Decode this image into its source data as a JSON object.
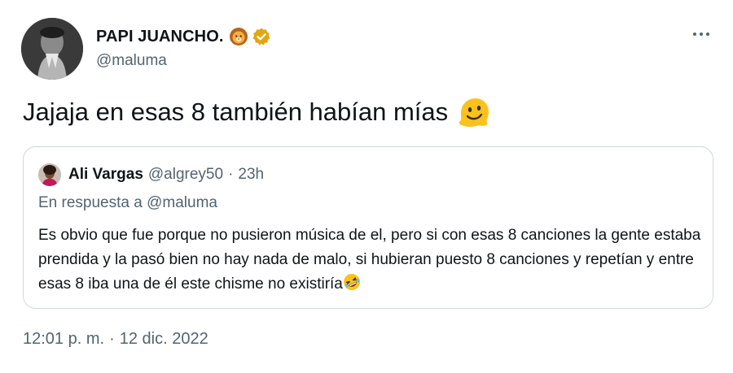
{
  "author": {
    "display_name": "PAPI JUANCHO.",
    "handle": "@maluma",
    "emoji_icon": "lion-face-icon",
    "verified_icon": "verified-badge-icon",
    "verified_color": "#e2a612"
  },
  "tweet": {
    "text": "Jajaja en esas 8 también habían mías",
    "emoji_icon": "melting-face-icon"
  },
  "quote": {
    "name": "Ali Vargas",
    "handle": "@algrey50",
    "separator": "·",
    "time": "23h",
    "reply_prefix": "En respuesta a",
    "reply_mention": "@maluma",
    "text": "Es obvio que fue porque no pusieron música de el, pero si con esas 8 canciones la gente estaba prendida y la pasó bien no hay nada de malo, si hubieran puesto 8 canciones y repetían y entre esas 8 iba una de él este chisme no existiría",
    "emoji_icon": "rolling-on-floor-laughing-icon"
  },
  "footer": {
    "time": "12:01 p. m.",
    "separator": "·",
    "date": "12 dic. 2022"
  },
  "colors": {
    "text_primary": "#0f1419",
    "text_secondary": "#536471",
    "border": "#cfd9de"
  }
}
